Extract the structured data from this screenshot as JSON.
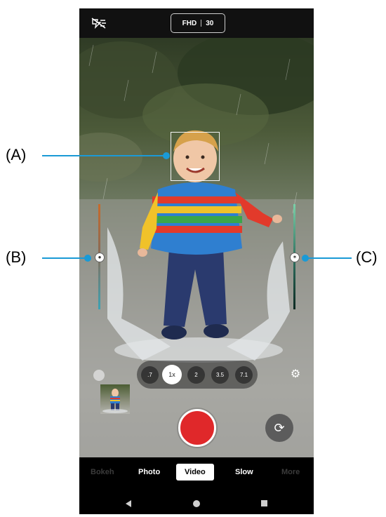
{
  "status_bar": {
    "flash_icon": "flash-off-icon",
    "resolution": "FHD",
    "frame_rate": "30"
  },
  "viewfinder": {
    "exposure_slider": {
      "icon": "exposure-icon"
    },
    "white_balance_slider": {
      "icon": "white-balance-icon"
    },
    "mode_icon": "bokeh-effect-icon",
    "settings_icon": "gear-icon"
  },
  "zoom": {
    "levels": [
      ".7",
      "1x",
      "2",
      "3.5",
      "7.1"
    ],
    "selected": "1x"
  },
  "controls": {
    "thumbnail": "last-capture-thumbnail",
    "record": "record-button",
    "switch_camera_icon": "switch-camera-icon"
  },
  "modes": {
    "items": [
      "Bokeh",
      "Photo",
      "Video",
      "Slow",
      "More"
    ],
    "active": "Video"
  },
  "callouts": {
    "a": "(A)",
    "b": "(B)",
    "c": "(C)"
  },
  "colors": {
    "callout": "#1a9ad6",
    "record": "#e0282a"
  }
}
